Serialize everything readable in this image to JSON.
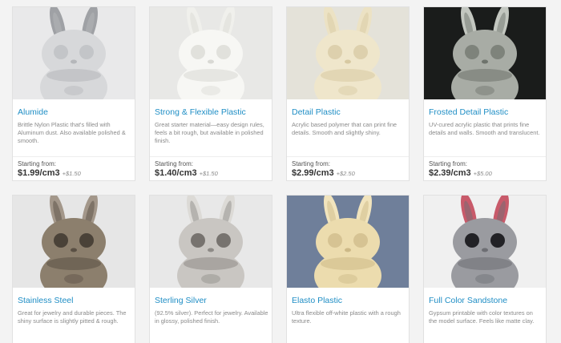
{
  "materials": [
    {
      "name": "Alumide",
      "description": "Brittle Nylon Plastic that's filled with Aluminum dust. Also available polished & smooth.",
      "starting_label": "Starting from:",
      "price": "$1.99/cm3",
      "extra": "+$1.50",
      "colors": {
        "bg": "#e9e9ea",
        "body": "#d7d8da",
        "shade": "#b5b7ba",
        "ear": "#9fa1a5",
        "eye": "#c3c5c8"
      }
    },
    {
      "name": "Strong & Flexible Plastic",
      "description": "Great starter material—easy design rules, feels a bit rough, but available in polished finish.",
      "starting_label": "Starting from:",
      "price": "$1.40/cm3",
      "extra": "+$1.50",
      "colors": {
        "bg": "#e8e8e6",
        "body": "#f7f7f4",
        "shade": "#d9d9d4",
        "ear": "#f0f0ec",
        "eye": "#e1e1dc"
      }
    },
    {
      "name": "Detail Plastic",
      "description": "Acrylic based polymer that can print fine details. Smooth and slightly shiny.",
      "starting_label": "Starting from:",
      "price": "$2.99/cm3",
      "extra": "+$2.50",
      "colors": {
        "bg": "#e4e2d9",
        "body": "#efe6cb",
        "shade": "#d7c9a2",
        "ear": "#ece2c4",
        "eye": "#ddd0ad"
      }
    },
    {
      "name": "Frosted Detail Plastic",
      "description": "UV-cured acrylic plastic that prints fine details and walls. Smooth and translucent.",
      "starting_label": "Starting from:",
      "price": "$2.39/cm3",
      "extra": "+$5.00",
      "colors": {
        "bg": "#1a1c1b",
        "body": "#a8aca5",
        "shade": "#6e736c",
        "ear": "#c3c7c0",
        "eye": "#7e837b"
      }
    },
    {
      "name": "Stainless Steel",
      "description": "Great for jewelry and durable pieces. The shiny surface is slightly pitted & rough.",
      "colors": {
        "bg": "#e6e6e6",
        "body": "#8c7f6d",
        "shade": "#5a5044",
        "ear": "#a3978a",
        "eye": "#4a4238"
      }
    },
    {
      "name": "Sterling Silver",
      "description": "(92.5% silver). Perfect for jewelry. Available in glossy, polished finish.",
      "colors": {
        "bg": "#e8e8e8",
        "body": "#c9c6c2",
        "shade": "#8e8b87",
        "ear": "#dcdad6",
        "eye": "#77736f"
      }
    },
    {
      "name": "Elasto Plastic",
      "description": "Ultra flexible off-white plastic with a rough texture.",
      "colors": {
        "bg": "#6f7f9a",
        "body": "#ecdcae",
        "shade": "#cdb987",
        "ear": "#f1e4bd",
        "eye": "#d6c393"
      }
    },
    {
      "name": "Full Color Sandstone",
      "description": "Gypsum printable with color textures on the model surface. Feels like matte clay.",
      "colors": {
        "bg": "#f0f0f0",
        "body": "#9a9ba0",
        "shade": "#6d6e73",
        "ear": "#c85a6a",
        "eye": "#222226"
      }
    }
  ]
}
